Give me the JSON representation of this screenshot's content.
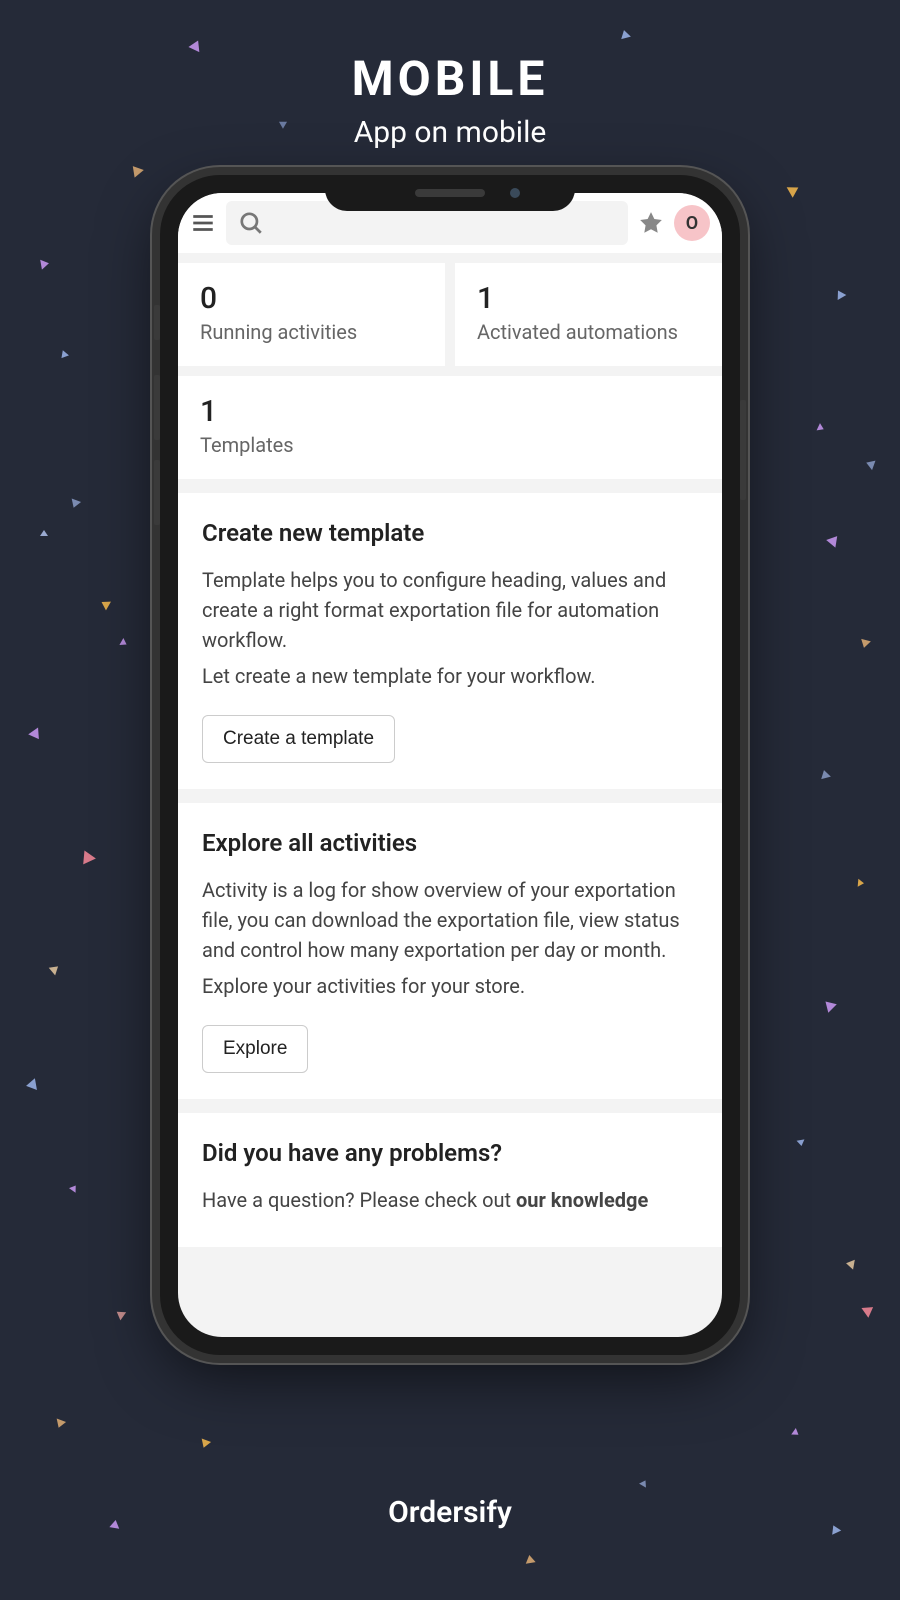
{
  "header": {
    "title": "MOBILE",
    "subtitle": "App on mobile"
  },
  "topbar": {
    "avatar_initial": "O"
  },
  "stats": {
    "running_activities": {
      "value": "0",
      "label": "Running activities"
    },
    "activated_automations": {
      "value": "1",
      "label": "Activated automations"
    },
    "templates": {
      "value": "1",
      "label": "Templates"
    }
  },
  "sections": {
    "create_template": {
      "title": "Create new template",
      "text1": "Template helps you to configure heading, values and create a right format exportation file for automation workflow.",
      "text2": "Let create a new template for your workflow.",
      "button": "Create a template"
    },
    "explore": {
      "title": "Explore all activities",
      "text1": "Activity is a log for show overview of your exportation file, you can download the exportation file, view status and control how many exportation per day or month.",
      "text2": "Explore your activities for your store.",
      "button": "Explore"
    },
    "problems": {
      "title": "Did you have any problems?",
      "text_prefix": "Have a question? Please check out ",
      "text_bold": "our knowledge"
    }
  },
  "brand": "Ordersify"
}
